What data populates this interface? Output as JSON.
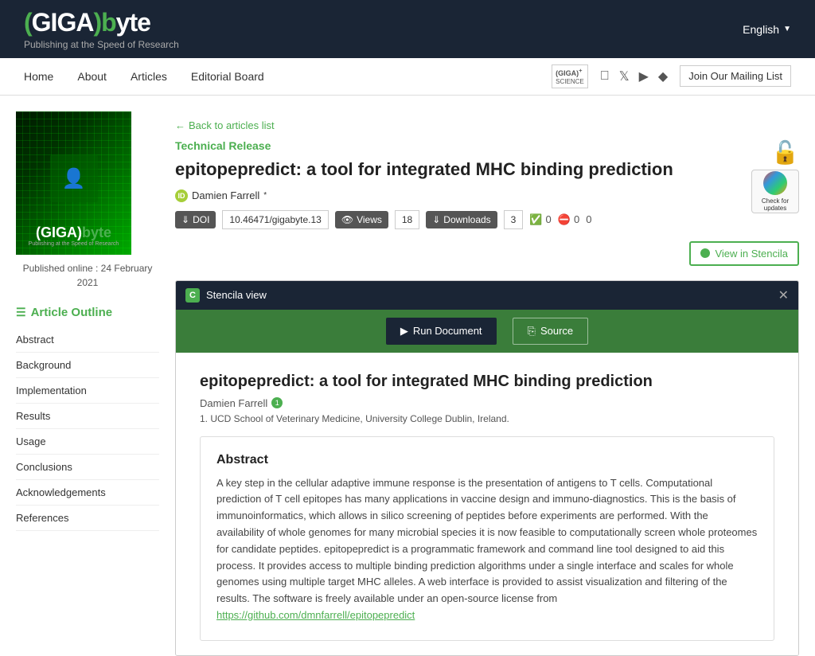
{
  "header": {
    "logo_main": "(GIGA)byte",
    "logo_subtitle": "Publishing at the Speed of Research",
    "language": "English",
    "nav": {
      "home": "Home",
      "about": "About",
      "articles": "Articles",
      "editorial_board": "Editorial Board",
      "mailing": "Join Our Mailing List"
    }
  },
  "sidebar": {
    "published_label": "Published online : 24 February",
    "published_year": "2021",
    "outline_title": "Article Outline",
    "outline_items": [
      "Abstract",
      "Background",
      "Implementation",
      "Results",
      "Usage",
      "Conclusions",
      "Acknowledgements",
      "References"
    ]
  },
  "article": {
    "back_link": "Back to articles list",
    "type": "Technical Release",
    "title": "epitopepredict: a tool for integrated MHC binding prediction",
    "author": "Damien Farrell",
    "doi_label": "DOI",
    "doi_value": "10.46471/gigabyte.13",
    "views_label": "Views",
    "views_count": "18",
    "downloads_label": "Downloads",
    "downloads_count": "3",
    "likes_count": "0",
    "dislikes_count": "0",
    "anon_count": "0",
    "stencila_btn": "View in Stencila"
  },
  "stencila": {
    "panel_title": "Stencila view",
    "run_doc_btn": "Run Document",
    "source_btn": "Source",
    "article_title": "epitopepredict: a tool for integrated MHC binding prediction",
    "author": "Damien Farrell",
    "affiliation_num": "1",
    "affiliation": "1. UCD School of Veterinary Medicine, University College Dublin, Ireland.",
    "abstract_title": "Abstract",
    "abstract_text": "A key step in the cellular adaptive immune response is the presentation of antigens to T cells. Computational prediction of T cell epitopes has many applications in vaccine design and immuno-diagnostics. This is the basis of immunoinformatics, which allows in silico screening of peptides before experiments are performed. With the availability of whole genomes for many microbial species it is now feasible to computationally screen whole proteomes for candidate peptides. epitopepredict is a programmatic framework and command line tool designed to aid this process. It provides access to multiple binding prediction algorithms under a single interface and scales for whole genomes using multiple target MHC alleles. A web interface is provided to assist visualization and filtering of the results. The software is freely available under an open-source license from",
    "abstract_link": "https://github.com/dmnfarrell/epitopepredict",
    "e_source_label": "E Source"
  }
}
